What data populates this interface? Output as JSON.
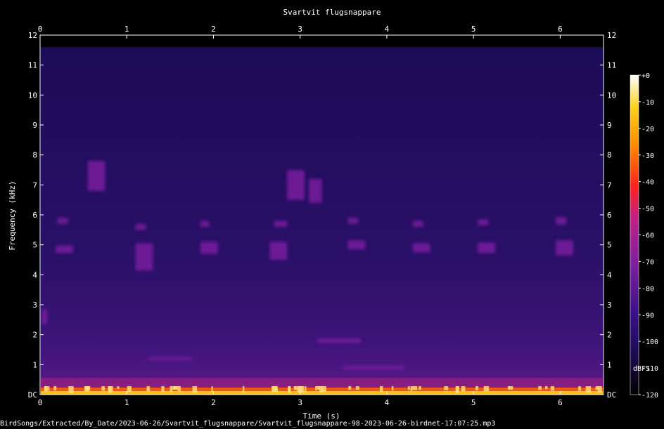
{
  "chart_data": {
    "type": "heatmap",
    "title": "Svartvit flugsnappare",
    "xlabel": "Time (s)",
    "ylabel": "Frequency (kHz)",
    "xlim": [
      0,
      6.5
    ],
    "ylim": [
      0,
      12
    ],
    "x_ticks": [
      "0",
      "1",
      "2",
      "3",
      "4",
      "5",
      "6"
    ],
    "y_ticks": [
      "DC",
      "1",
      "2",
      "3",
      "4",
      "5",
      "6",
      "7",
      "8",
      "9",
      "10",
      "11",
      "12"
    ],
    "grid": false,
    "colorbar": {
      "label": "dBFS",
      "range": [
        -120,
        0
      ],
      "ticks": [
        "+0",
        "-10",
        "-20",
        "-30",
        "-40",
        "-50",
        "-60",
        "-70",
        "-80",
        "-90",
        "-100",
        "-110",
        "-120"
      ]
    },
    "colormap": [
      "#000000",
      "#1a0a4d",
      "#3a0f8a",
      "#7a1fa0",
      "#c0208a",
      "#ff2020",
      "#ff8a00",
      "#ffd21f",
      "#ffffff"
    ],
    "noise_floor_khz": 11.6,
    "calls": [
      {
        "t": 0.02,
        "f": 2.6,
        "dt": 0.06,
        "df": 0.5,
        "level": -70
      },
      {
        "t": 0.18,
        "f": 4.85,
        "dt": 0.2,
        "df": 0.25,
        "level": -70
      },
      {
        "t": 0.2,
        "f": 5.8,
        "dt": 0.12,
        "df": 0.2,
        "level": -75
      },
      {
        "t": 0.55,
        "f": 7.3,
        "dt": 0.2,
        "df": 1.0,
        "level": -75
      },
      {
        "t": 1.1,
        "f": 4.6,
        "dt": 0.2,
        "df": 0.9,
        "level": -70
      },
      {
        "t": 1.1,
        "f": 5.6,
        "dt": 0.12,
        "df": 0.2,
        "level": -78
      },
      {
        "t": 1.85,
        "f": 4.9,
        "dt": 0.2,
        "df": 0.4,
        "level": -75
      },
      {
        "t": 1.85,
        "f": 5.7,
        "dt": 0.1,
        "df": 0.2,
        "level": -80
      },
      {
        "t": 2.65,
        "f": 4.8,
        "dt": 0.2,
        "df": 0.6,
        "level": -70
      },
      {
        "t": 2.7,
        "f": 5.7,
        "dt": 0.15,
        "df": 0.2,
        "level": -75
      },
      {
        "t": 2.85,
        "f": 7.0,
        "dt": 0.2,
        "df": 1.0,
        "level": -72
      },
      {
        "t": 3.1,
        "f": 6.8,
        "dt": 0.15,
        "df": 0.8,
        "level": -75
      },
      {
        "t": 3.55,
        "f": 5.0,
        "dt": 0.2,
        "df": 0.3,
        "level": -70
      },
      {
        "t": 3.55,
        "f": 5.8,
        "dt": 0.12,
        "df": 0.2,
        "level": -75
      },
      {
        "t": 4.3,
        "f": 4.9,
        "dt": 0.2,
        "df": 0.3,
        "level": -72
      },
      {
        "t": 4.3,
        "f": 5.7,
        "dt": 0.12,
        "df": 0.2,
        "level": -78
      },
      {
        "t": 5.05,
        "f": 4.9,
        "dt": 0.2,
        "df": 0.35,
        "level": -72
      },
      {
        "t": 5.05,
        "f": 5.75,
        "dt": 0.12,
        "df": 0.2,
        "level": -78
      },
      {
        "t": 5.95,
        "f": 4.9,
        "dt": 0.2,
        "df": 0.5,
        "level": -70
      },
      {
        "t": 5.95,
        "f": 5.8,
        "dt": 0.12,
        "df": 0.25,
        "level": -78
      },
      {
        "t": 3.5,
        "f": 0.9,
        "dt": 0.7,
        "df": 0.12,
        "level": -75
      },
      {
        "t": 1.25,
        "f": 1.2,
        "dt": 0.5,
        "df": 0.1,
        "level": -80
      },
      {
        "t": 3.2,
        "f": 1.8,
        "dt": 0.5,
        "df": 0.15,
        "level": -78
      }
    ]
  },
  "footer": {
    "path": "BirdSongs/Extracted/By_Date/2023-06-26/Svartvit_flugsnappare/Svartvit_flugsnappare-98-2023-06-26-birdnet-17:07:25.mp3"
  }
}
